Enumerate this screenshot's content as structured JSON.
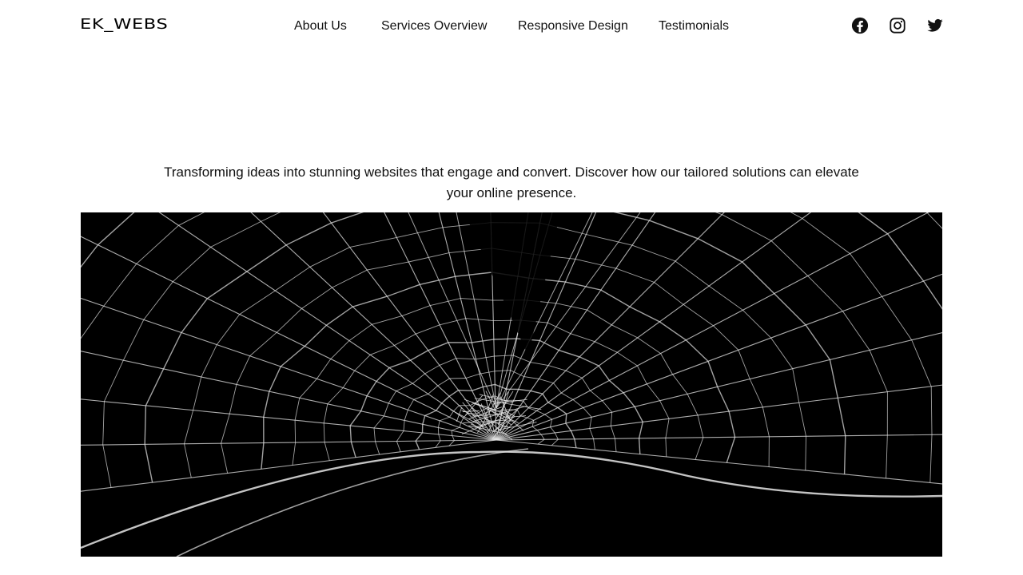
{
  "header": {
    "logo": "EK_WEBS",
    "nav": [
      {
        "label": "About Us"
      },
      {
        "label": "Services Overview"
      },
      {
        "label": "Responsive Design"
      },
      {
        "label": "Testimonials"
      }
    ],
    "social": [
      {
        "icon": "facebook-icon"
      },
      {
        "icon": "instagram-icon"
      },
      {
        "icon": "twitter-icon"
      }
    ]
  },
  "intro": {
    "text": "Transforming ideas into stunning websites that engage and convert. Discover how our tailored solutions can elevate your online presence."
  },
  "hero": {
    "image": "spider-web-photo",
    "background": "#000000",
    "strand_color": "#e6e6e6"
  }
}
